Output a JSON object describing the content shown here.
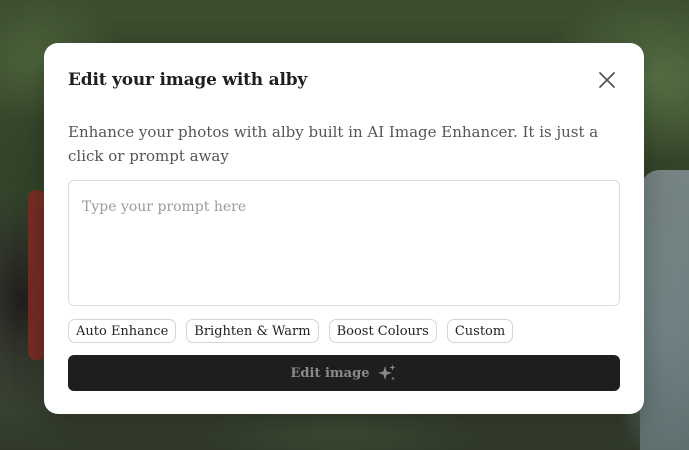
{
  "modal": {
    "title": "Edit your image with alby",
    "description": "Enhance your photos with alby built in AI Image Enhancer. It is just a click or prompt away",
    "prompt": {
      "value": "",
      "placeholder": "Type your prompt here"
    },
    "presets": [
      "Auto Enhance",
      "Brighten & Warm",
      "Boost Colours",
      "Custom"
    ],
    "submit_label": "Edit image",
    "submit_icon": "sparkle-icon",
    "close_icon": "close-icon"
  },
  "colors": {
    "button_bg": "#1e1e1e",
    "button_text_disabled": "#8a8a8a",
    "modal_bg": "#ffffff"
  }
}
